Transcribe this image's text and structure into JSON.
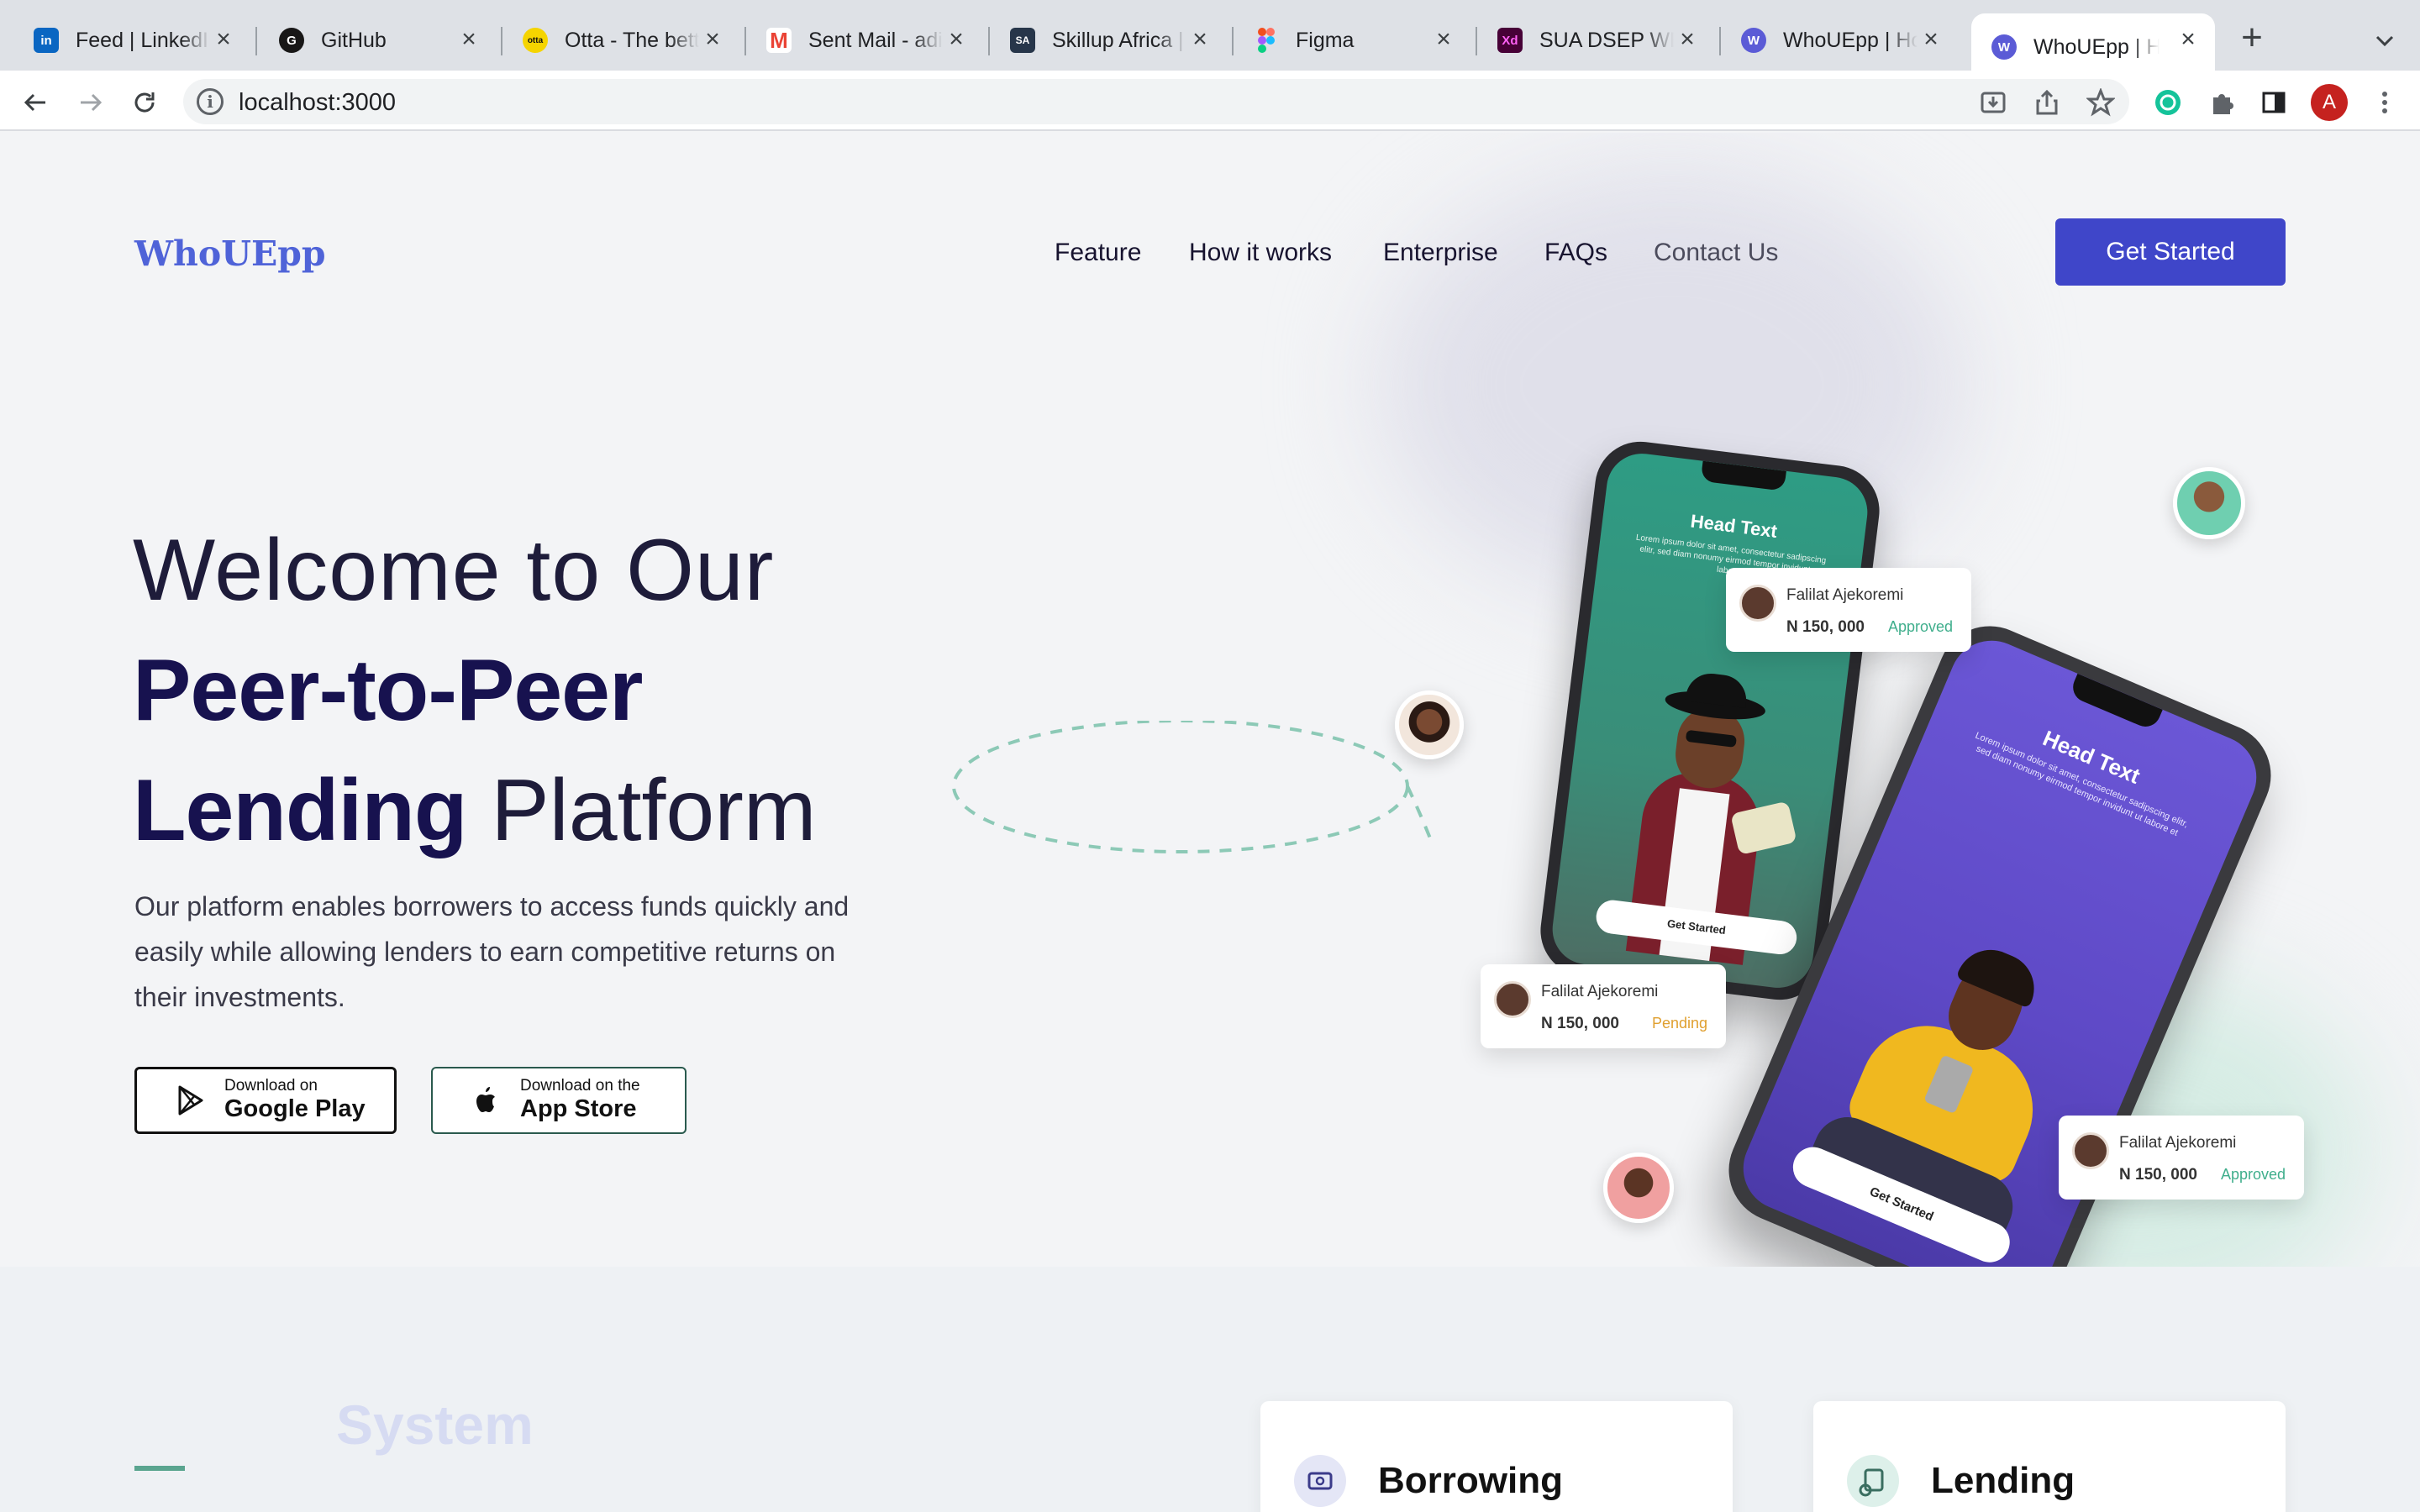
{
  "browser": {
    "tabs": [
      {
        "title": "Feed | LinkedIn",
        "favicon": "linkedin-icon",
        "color": "#0a66c2",
        "glyph": "in"
      },
      {
        "title": "GitHub",
        "favicon": "github-icon",
        "color": "#181717",
        "glyph": "G"
      },
      {
        "title": "Otta - The better",
        "favicon": "otta-icon",
        "color": "#f5d400",
        "glyph": "otta"
      },
      {
        "title": "Sent Mail - adi",
        "favicon": "gmail-icon",
        "color": "#ea4335",
        "glyph": "M"
      },
      {
        "title": "Skillup Africa |",
        "favicon": "skillup-icon",
        "color": "#27364a",
        "glyph": "SA"
      },
      {
        "title": "Figma",
        "favicon": "figma-icon",
        "color": "#a259ff",
        "glyph": "F"
      },
      {
        "title": "SUA DSEP WEB",
        "favicon": "xd-icon",
        "color": "#470137",
        "glyph": "Xd"
      },
      {
        "title": "WhoUEpp | Home",
        "favicon": "whouepp-icon",
        "color": "#5b5bd6",
        "glyph": "W"
      },
      {
        "title": "WhoUEpp | Home",
        "favicon": "whouepp-icon",
        "color": "#5b5bd6",
        "glyph": "W"
      }
    ],
    "url": "localhost:3000",
    "profile_initial": "A"
  },
  "site": {
    "logo": "WhoUEpp",
    "nav": [
      "Feature",
      "How it works",
      "Enterprise",
      "FAQs",
      "Contact Us"
    ],
    "cta": "Get Started"
  },
  "hero": {
    "line1": "Welcome to Our",
    "line2": "Peer-to-Peer",
    "line3_bold": "Lending",
    "line3_light": " Platform",
    "description": "Our platform enables borrowers to access funds quickly and easily while allowing lenders to earn competitive returns on their investments.",
    "google_play": {
      "small": "Download on",
      "big": "Google Play"
    },
    "app_store": {
      "small": "Download on the",
      "big": "App Store"
    }
  },
  "mockup": {
    "phone1": {
      "head": "Head Text",
      "body": "Lorem ipsum dolor sit amet, consectetur sadipscing elitr, sed diam nonumy eirmod tempor invidunt ut labore",
      "button": "Get Started"
    },
    "phone2": {
      "head": "Head Text",
      "body": "Lorem ipsum dolor sit amet, consectetur sadipscing elitr, sed diam nonumy eirmod tempor invidunt ut labore et",
      "button": "Get Started"
    },
    "cards": [
      {
        "name": "Falilat Ajekoremi",
        "amount": "N 150, 000",
        "status": "Approved",
        "status_color": "#3fae8c"
      },
      {
        "name": "Falilat Ajekoremi",
        "amount": "N 150, 000",
        "status": "Pending",
        "status_color": "#e0a030"
      },
      {
        "name": "Falilat Ajekoremi",
        "amount": "N 150, 000",
        "status": "Approved",
        "status_color": "#3fae8c"
      }
    ]
  },
  "features": {
    "section_label": "System",
    "cards": [
      {
        "title": "Borrowing",
        "icon": "borrowing-icon"
      },
      {
        "title": "Lending",
        "icon": "lending-icon"
      }
    ]
  }
}
